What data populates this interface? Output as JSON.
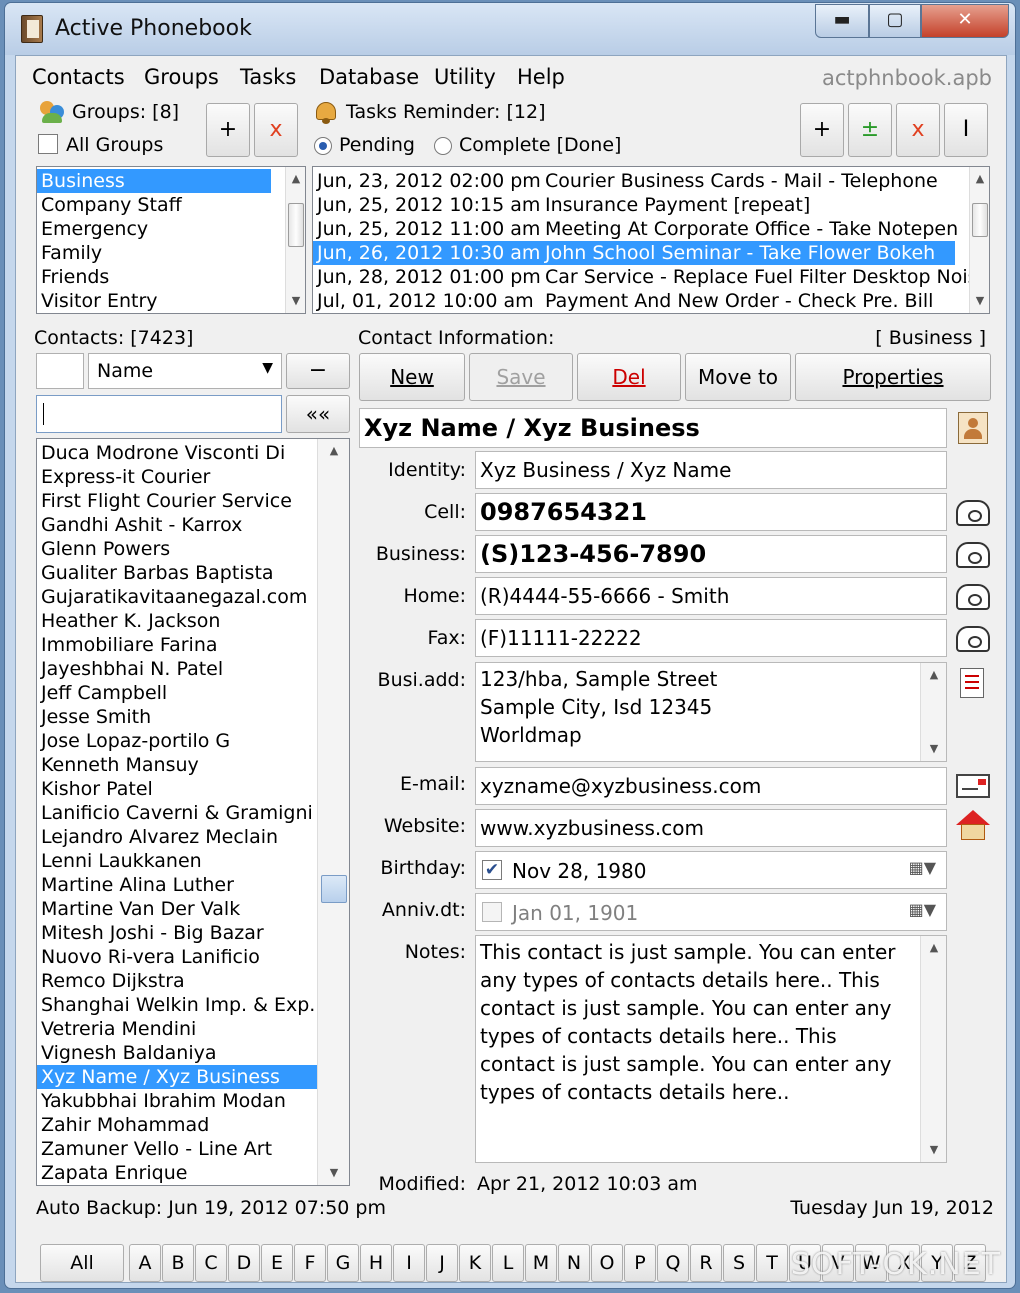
{
  "window": {
    "title": "Active Phonebook",
    "min": "▬",
    "max": "▢",
    "close": "✕"
  },
  "menu": {
    "items": [
      "Contacts",
      "Groups",
      "Tasks",
      "Database",
      "Utility",
      "Help"
    ],
    "dbname": "actphnbook.apb"
  },
  "groups": {
    "label": "Groups: [8]",
    "all_groups": "All Groups",
    "add": "+",
    "remove": "x",
    "items": [
      "Business",
      "Company Staff",
      "Emergency",
      "Family",
      "Friends",
      "Visitor Entry"
    ],
    "selected": 0
  },
  "tasks": {
    "label": "Tasks Reminder: [12]",
    "pending": "Pending",
    "complete": "Complete [Done]",
    "buttons": [
      "+",
      "±",
      "x",
      "I"
    ],
    "items": [
      {
        "date": "Jun, 23, 2012 02:00 pm",
        "text": "Courier Business Cards - Mail - Telephone"
      },
      {
        "date": "Jun, 25, 2012 10:15 am",
        "text": "Insurance Payment [repeat]"
      },
      {
        "date": "Jun, 25, 2012 11:00 am",
        "text": "Meeting At Corporate Office - Take Notepen"
      },
      {
        "date": "Jun, 26, 2012 10:30 am",
        "text": "John School Seminar - Take Flower Bokeh"
      },
      {
        "date": "Jun, 28, 2012 01:00 pm",
        "text": "Car Service - Replace Fuel Filter Desktop Noise"
      },
      {
        "date": "Jul, 01, 2012 10:00 am",
        "text": "Payment And New Order - Check Pre. Bill"
      }
    ],
    "selected": 3
  },
  "contacts": {
    "label": "Contacts: [7423]",
    "sort": "Name",
    "minus": "−",
    "clear": "««",
    "search_value": "",
    "items": [
      "Duca Modrone Visconti Di",
      "Express-it Courier",
      "First Flight Courier Service",
      "Gandhi Ashit - Karrox",
      "Glenn Powers",
      "Gualiter Barbas Baptista",
      "Gujaratikavitaanegazal.com",
      "Heather K. Jackson",
      "Immobiliare Farina",
      "Jayeshbhai N. Patel",
      "Jeff Campbell",
      "Jesse Smith",
      "Jose Lopaz-portilo G",
      "Kenneth Mansuy",
      "Kishor Patel",
      "Lanificio Caverni & Gramigni",
      "Lejandro Alvarez Meclain",
      "Lenni Laukkanen",
      "Martine Alina Luther",
      "Martine Van Der Valk",
      "Mitesh Joshi - Big Bazar",
      "Nuovo Ri-vera Lanificio",
      "Remco Dijkstra",
      "Shanghai Welkin Imp. & Exp.",
      "Vetreria Mendini",
      "Vignesh Baldaniya",
      "Xyz Name / Xyz Business",
      "Yakubbhai Ibrahim Modan",
      "Zahir Mohammad",
      "Zamuner Vello - Line Art",
      "Zapata Enrique"
    ],
    "selected": 26
  },
  "info": {
    "label": "Contact Information:",
    "group_tag": "[ Business ]",
    "buttons": {
      "new": "New",
      "save": "Save",
      "del": "Del",
      "move": "Move to",
      "props": "Properties"
    },
    "heading": "Xyz Name / Xyz Business",
    "labels": {
      "identity": "Identity:",
      "cell": "Cell:",
      "business": "Business:",
      "home": "Home:",
      "fax": "Fax:",
      "address": "Busi.add:",
      "email": "E-mail:",
      "website": "Website:",
      "birthday": "Birthday:",
      "anniv": "Anniv.dt:",
      "notes": "Notes:",
      "modified": "Modified:"
    },
    "identity": "Xyz Business / Xyz Name",
    "cell": "0987654321",
    "business": "(S)123-456-7890",
    "home": "(R)4444-55-6666 - Smith",
    "fax": "(F)11111-22222",
    "address": [
      "123/hba, Sample Street",
      "Sample City, Isd  12345",
      "Worldmap"
    ],
    "email": "xyzname@xyzbusiness.com",
    "website": "www.xyzbusiness.com",
    "birthday": "Nov 28, 1980",
    "anniv": "Jan 01, 1901",
    "notes": "This contact is just sample. You can enter any types of contacts details here.. This contact is just sample. You can enter any types of contacts details here.. This contact is just sample. You can enter any types of contacts details here..",
    "modified": "Apr 21, 2012 10:03 am"
  },
  "status": {
    "backup": "Auto Backup: Jun 19, 2012 07:50 pm",
    "date": "Tuesday  Jun 19, 2012"
  },
  "alphabet": [
    "All",
    "A",
    "B",
    "C",
    "D",
    "E",
    "F",
    "G",
    "H",
    "I",
    "J",
    "K",
    "L",
    "M",
    "N",
    "O",
    "P",
    "Q",
    "R",
    "S",
    "T",
    "U",
    "V",
    "W",
    "X",
    "Y",
    "Z"
  ],
  "watermark": "SOFT-OK.NET",
  "colors": {
    "selection": "#3399ff",
    "del_text": "#cc0000",
    "add_green": "#2a9a2a"
  }
}
